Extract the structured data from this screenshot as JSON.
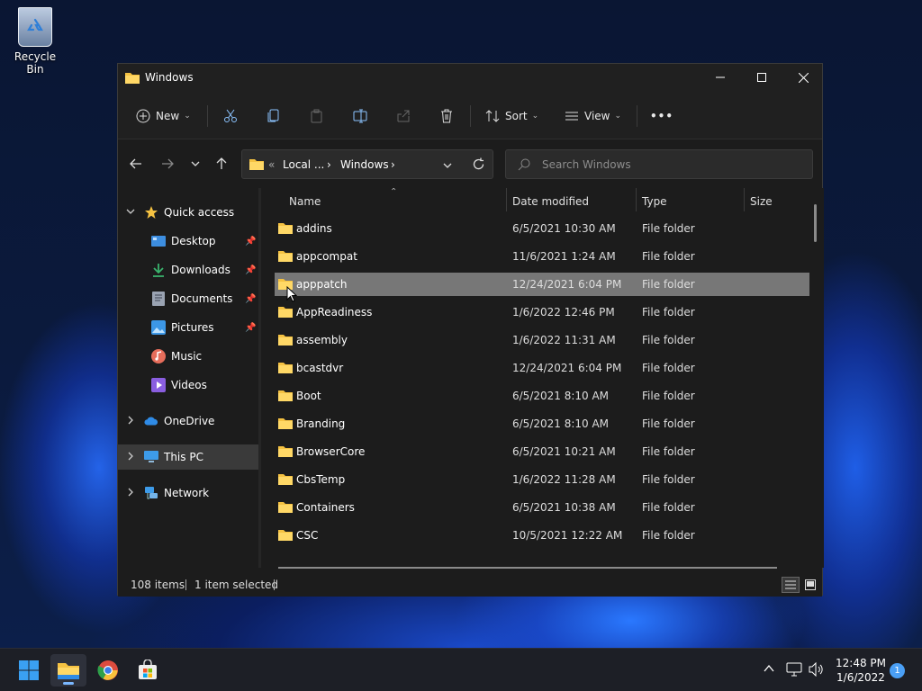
{
  "desktop": {
    "icons": [
      {
        "label": "Recycle Bin",
        "icon": "recycle-bin-icon"
      }
    ]
  },
  "window": {
    "title": "Windows",
    "controls": {
      "minimize": "minimize",
      "maximize": "maximize",
      "close": "close"
    }
  },
  "toolbar": {
    "new_label": "New",
    "sort_label": "Sort",
    "view_label": "View",
    "more_label": "•••",
    "icons": [
      "add-icon",
      "cut-icon",
      "copy-icon",
      "paste-icon",
      "rename-icon",
      "share-icon",
      "delete-icon",
      "sort-icon",
      "view-icon"
    ]
  },
  "nav": {
    "breadcrumb": {
      "overflow": "«",
      "segments": [
        "Local ...",
        "Windows"
      ]
    },
    "search_placeholder": "Search Windows"
  },
  "sidebar": {
    "quick_access": "Quick access",
    "items": [
      {
        "label": "Desktop",
        "pinned": true,
        "icon": "desktop-icon",
        "color": "#3d8ee0"
      },
      {
        "label": "Downloads",
        "pinned": true,
        "icon": "download-icon",
        "color": "#3ab46d"
      },
      {
        "label": "Documents",
        "pinned": true,
        "icon": "documents-icon",
        "color": "#9aa3b2"
      },
      {
        "label": "Pictures",
        "pinned": true,
        "icon": "pictures-icon",
        "color": "#3c97e6"
      },
      {
        "label": "Music",
        "pinned": false,
        "icon": "music-icon",
        "color": "#e66d5b"
      },
      {
        "label": "Videos",
        "pinned": false,
        "icon": "videos-icon",
        "color": "#8a5ee0"
      }
    ],
    "onedrive": "OneDrive",
    "this_pc": "This PC",
    "network": "Network"
  },
  "filelist": {
    "columns": {
      "name": "Name",
      "date": "Date modified",
      "type": "Type",
      "size": "Size"
    },
    "selected_index": 2,
    "rows": [
      {
        "name": "addins",
        "date": "6/5/2021 10:30 AM",
        "type": "File folder"
      },
      {
        "name": "appcompat",
        "date": "11/6/2021 1:24 AM",
        "type": "File folder"
      },
      {
        "name": "apppatch",
        "date": "12/24/2021 6:04 PM",
        "type": "File folder"
      },
      {
        "name": "AppReadiness",
        "date": "1/6/2022 12:46 PM",
        "type": "File folder"
      },
      {
        "name": "assembly",
        "date": "1/6/2022 11:31 AM",
        "type": "File folder"
      },
      {
        "name": "bcastdvr",
        "date": "12/24/2021 6:04 PM",
        "type": "File folder"
      },
      {
        "name": "Boot",
        "date": "6/5/2021 8:10 AM",
        "type": "File folder"
      },
      {
        "name": "Branding",
        "date": "6/5/2021 8:10 AM",
        "type": "File folder"
      },
      {
        "name": "BrowserCore",
        "date": "6/5/2021 10:21 AM",
        "type": "File folder"
      },
      {
        "name": "CbsTemp",
        "date": "1/6/2022 11:28 AM",
        "type": "File folder"
      },
      {
        "name": "Containers",
        "date": "6/5/2021 10:38 AM",
        "type": "File folder"
      },
      {
        "name": "CSC",
        "date": "10/5/2021 12:22 AM",
        "type": "File folder"
      }
    ]
  },
  "status": {
    "count": "108 items",
    "selection": "1 item selected"
  },
  "taskbar": {
    "apps": [
      "start-icon",
      "file-explorer-icon",
      "chrome-icon",
      "store-icon"
    ],
    "time": "12:48 PM",
    "date": "1/6/2022",
    "notifications": "1"
  },
  "colors": {
    "folder": "#f5c242",
    "selected_row": "#777777",
    "accent": "#4a9ff5"
  }
}
